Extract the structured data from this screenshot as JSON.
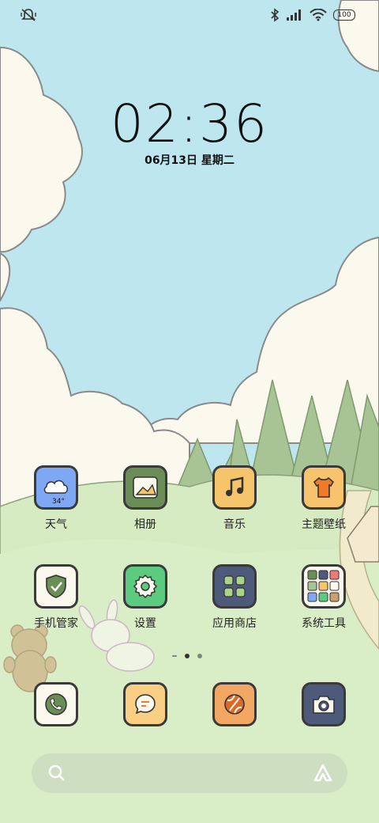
{
  "status_bar": {
    "left_icons": [
      "mute-vibrate-icon"
    ],
    "right_icons": [
      "bluetooth-icon",
      "signal-icon",
      "wifi-icon"
    ],
    "battery": "100"
  },
  "clock": {
    "time": "02:36",
    "date": "06月13日 星期二"
  },
  "apps": [
    {
      "label": "天气",
      "icon": "weather-cloud-icon",
      "badge": "34°",
      "color": "#7ea7f4"
    },
    {
      "label": "相册",
      "icon": "gallery-icon",
      "color": "#6a8e55"
    },
    {
      "label": "音乐",
      "icon": "music-note-icon",
      "color": "#f6c46a"
    },
    {
      "label": "主题壁纸",
      "icon": "tshirt-icon",
      "color": "#f7c36c"
    },
    {
      "label": "手机管家",
      "icon": "shield-check-icon",
      "color": "#fbf8ee"
    },
    {
      "label": "设置",
      "icon": "gear-icon",
      "color": "#5ccb80"
    },
    {
      "label": "应用商店",
      "icon": "app-store-grid-icon",
      "color": "#4e5a7a"
    },
    {
      "label": "系统工具",
      "icon": "folder-tools-icon",
      "color": "#fbf8ee"
    }
  ],
  "dock": [
    {
      "icon": "phone-icon",
      "color": "#fbf8ee"
    },
    {
      "icon": "message-icon",
      "color": "#f9cf84"
    },
    {
      "icon": "browser-icon",
      "color": "#f2a764"
    },
    {
      "icon": "camera-icon",
      "color": "#4e5a7a"
    }
  ],
  "page_indicator": {
    "pages": 2,
    "current": 1
  },
  "search_bar": {
    "icons": [
      "search-icon",
      "assistant-icon"
    ]
  }
}
